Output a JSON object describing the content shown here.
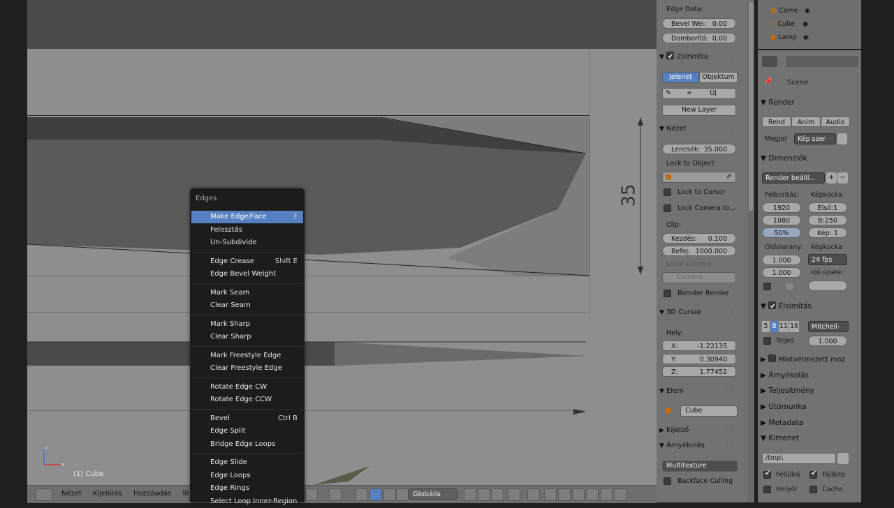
{
  "viewport": {
    "dimension_label": "35",
    "object_label": "(1) Cube"
  },
  "header": {
    "menus": [
      "Nézet",
      "Kijelölés",
      "Hozzáadás",
      "Té"
    ],
    "orientation": "Globális"
  },
  "edges_menu": {
    "title": "Edges",
    "groups": [
      [
        {
          "label": "Make Edge/Face",
          "shortcut": "F",
          "selected": true
        },
        {
          "label": "Felosztás",
          "shortcut": ""
        },
        {
          "label": "Un-Subdivide",
          "shortcut": ""
        }
      ],
      [
        {
          "label": "Edge Crease",
          "shortcut": "Shift E"
        },
        {
          "label": "Edge Bevel Weight",
          "shortcut": ""
        }
      ],
      [
        {
          "label": "Mark Seam",
          "shortcut": ""
        },
        {
          "label": "Clear Seam",
          "shortcut": ""
        }
      ],
      [
        {
          "label": "Mark Sharp",
          "shortcut": ""
        },
        {
          "label": "Clear Sharp",
          "shortcut": ""
        }
      ],
      [
        {
          "label": "Mark Freestyle Edge",
          "shortcut": ""
        },
        {
          "label": "Clear Freestyle Edge",
          "shortcut": ""
        }
      ],
      [
        {
          "label": "Rotate Edge CW",
          "shortcut": ""
        },
        {
          "label": "Rotate Edge CCW",
          "shortcut": ""
        }
      ],
      [
        {
          "label": "Bevel",
          "shortcut": "Ctrl B"
        },
        {
          "label": "Edge Split",
          "shortcut": ""
        },
        {
          "label": "Bridge Edge Loops",
          "shortcut": ""
        }
      ],
      [
        {
          "label": "Edge Slide",
          "shortcut": ""
        },
        {
          "label": "Edge Loops",
          "shortcut": ""
        },
        {
          "label": "Edge Rings",
          "shortcut": ""
        },
        {
          "label": "Select Loop Inner-Region",
          "shortcut": ""
        }
      ]
    ]
  },
  "properties": {
    "edge_data_label": "Edge Data:",
    "bevel_weight": {
      "label": "Bevel Wei:",
      "value": "0.00"
    },
    "crease": {
      "label": "Domborítá:",
      "value": "0.00"
    },
    "grease_pencil": {
      "label": "Zsírkréta",
      "checked": true
    },
    "tabs": [
      "Jelenet",
      "Objektum"
    ],
    "new_btn": "Új",
    "new_layer_btn": "New Layer",
    "view_section": "Nézet",
    "lens": {
      "label": "Lencsék:",
      "value": "35.000"
    },
    "lock_to_object": "Lock to Object:",
    "lock_cursor": "Lock to Cursor",
    "lock_camera": "Lock Camera to...",
    "clip_label": "Clip:",
    "clip_start": {
      "label": "Kezdés:",
      "value": "0.100"
    },
    "clip_end": {
      "label": "Befej:",
      "value": "1000.000"
    },
    "local_camera": "Local Camera:",
    "camera_field": "Camera",
    "blender_render": "Blender Render",
    "cursor_section": "3D Cursor",
    "location_label": "Hely:",
    "cursor_x": {
      "label": "X:",
      "value": "-1.22135"
    },
    "cursor_y": {
      "label": "Y:",
      "value": "0.30940"
    },
    "cursor_z": {
      "label": "Z:",
      "value": "1.77452"
    },
    "item_section": "Elem",
    "item_name": "Cube",
    "display_section": "Kijelző",
    "shading_section": "Árnyékolás",
    "shading_mode": "Multitexture",
    "backface_culling": "Backface Culling"
  },
  "outliner": {
    "rows": [
      "Came",
      "Cube",
      "Lamp"
    ]
  },
  "render_props": {
    "scene_label": "Scene",
    "render_section": "Render",
    "render_buttons": [
      "Rend",
      "Anim",
      "Audio"
    ],
    "display_label": "Megjel",
    "display_value": "Kép szer",
    "dimensions_section": "Dimenziók",
    "presets": "Render beállí...",
    "resolution_label": "Felbontás:",
    "res_x": "1920",
    "res_y": "1080",
    "res_pct": "50%",
    "frame_label": "Képkocka",
    "frame_start": "Első:1",
    "frame_end": "B:250",
    "frame_step": "Kép: 1",
    "aspect_label": "Oldalarány:",
    "aspect_x": "1.000",
    "aspect_y": "1.000",
    "fps_label": "Képkocka",
    "fps": "24 fps",
    "time_remap": "Idő újraté:",
    "aa_section": "Élsimítás",
    "aa_samples": [
      "5",
      "8",
      "11",
      "16"
    ],
    "aa_filter": "Mitchell-",
    "full_sample": "Teljes",
    "aa_size": "1.000",
    "sampled_motion": "Mintvételezett moz",
    "shading": "Árnyékolás",
    "performance": "Teljesítmény",
    "post": "Utómunka",
    "metadata": "Metadata",
    "output": "Kimenet",
    "output_path": "/tmp\\",
    "overwrite": "Felülírá",
    "file_ext": "Fájlkite",
    "placeholders": "Helyőr",
    "cache": "Cache"
  },
  "colors": {
    "menu_bg": "#1c1c1c",
    "menu_selected": "#5680c2",
    "panel_bg": "#727272",
    "tab_active": "#5680c2"
  }
}
